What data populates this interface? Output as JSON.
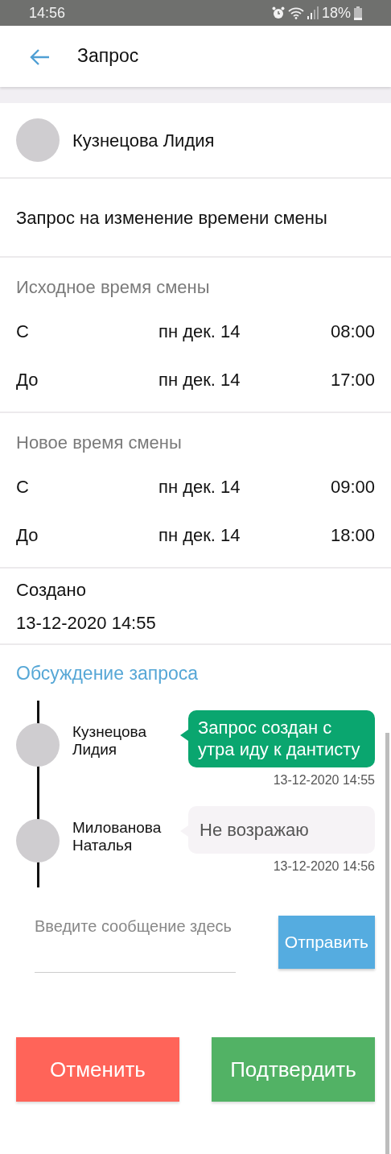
{
  "status_bar": {
    "time": "14:56",
    "battery": "18%"
  },
  "header": {
    "title": "Запрос"
  },
  "requester": {
    "name": "Кузнецова Лидия"
  },
  "request_title": "Запрос на изменение времени смены",
  "shift_sections": [
    {
      "heading": "Исходное время смены",
      "rows": [
        {
          "label": "С",
          "date": "пн дек. 14",
          "time": "08:00"
        },
        {
          "label": "До",
          "date": "пн дек. 14",
          "time": "17:00"
        }
      ]
    },
    {
      "heading": "Новое время смены",
      "rows": [
        {
          "label": "С",
          "date": "пн дек. 14",
          "time": "09:00"
        },
        {
          "label": "До",
          "date": "пн дек. 14",
          "time": "18:00"
        }
      ]
    }
  ],
  "created": {
    "label": "Создано",
    "value": "13-12-2020 14:55"
  },
  "discussion": {
    "heading": "Обсуждение запроса",
    "messages": [
      {
        "kind": "outgoing",
        "author": "Кузнецова Лидия",
        "text": "Запрос создан с утра иду к дантисту",
        "timestamp": "13-12-2020  14:55"
      },
      {
        "kind": "incoming",
        "author": "Милованова Наталья",
        "text": "Не возражаю",
        "timestamp": "13-12-2020  14:56"
      }
    ],
    "input": {
      "placeholder": "Введите сообщение здесь"
    },
    "send_button": "Отправить"
  },
  "actions": [
    {
      "kind": "cancel",
      "label": "Отменить"
    },
    {
      "kind": "confirm",
      "label": "Подтвердить"
    }
  ]
}
